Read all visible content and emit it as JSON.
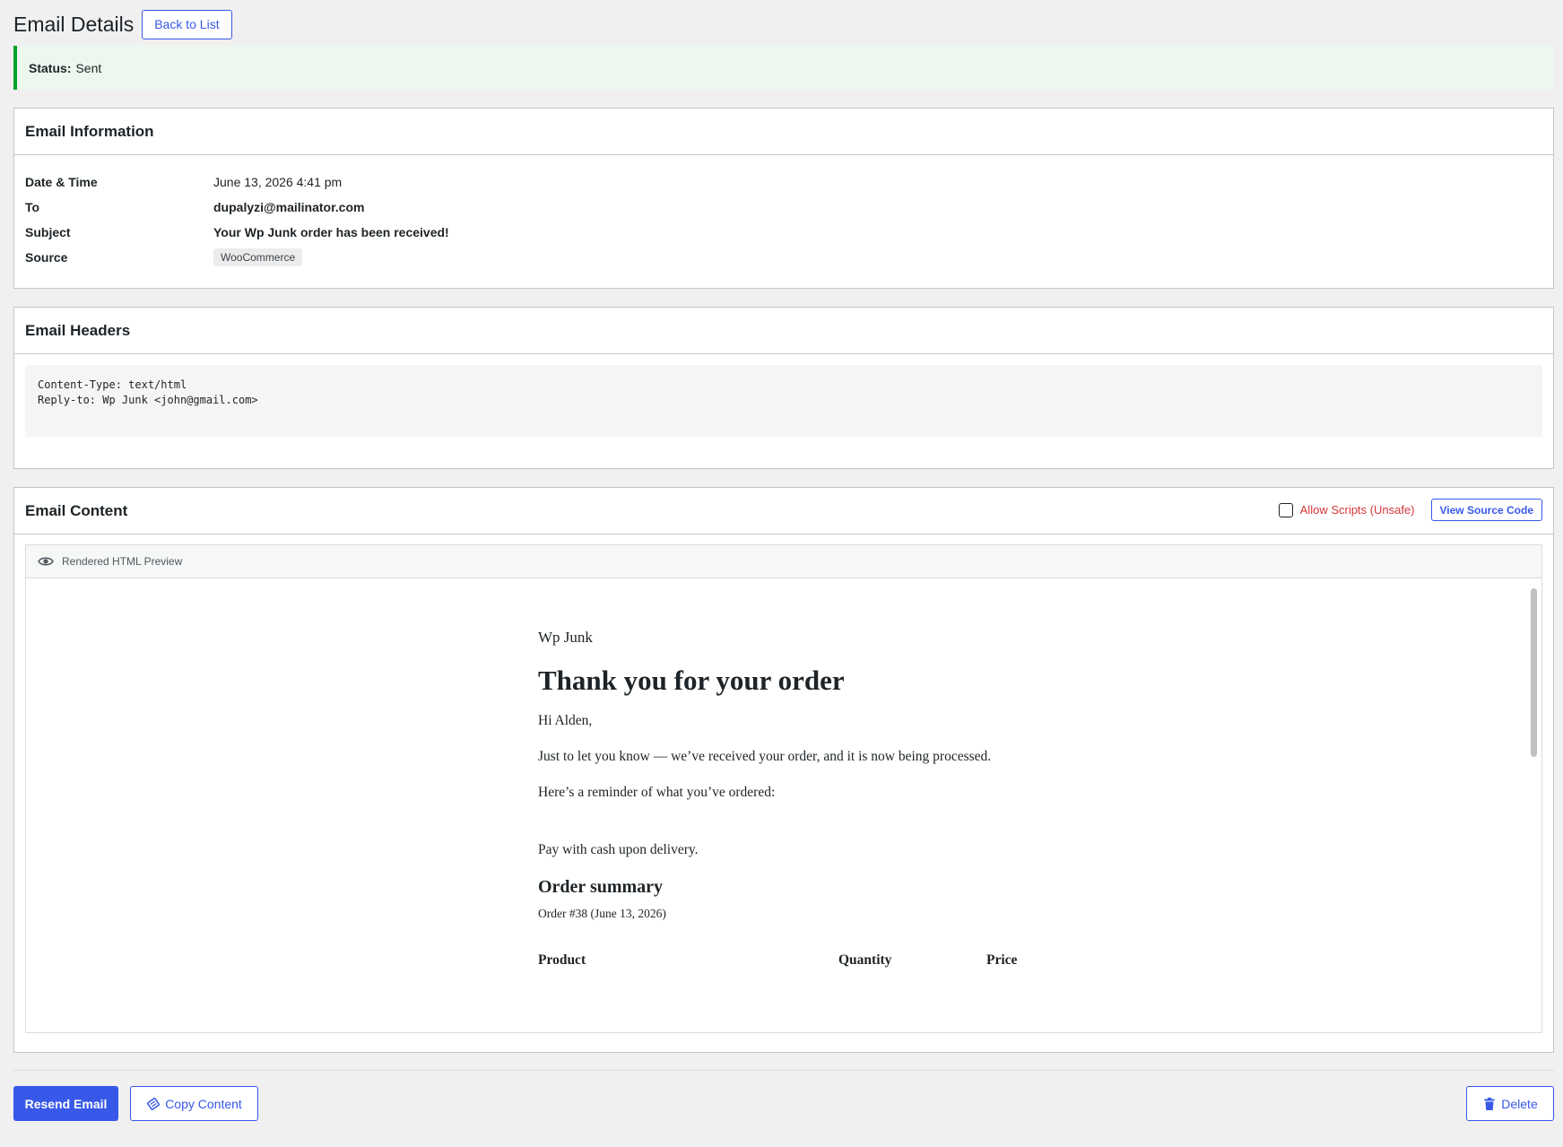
{
  "page": {
    "title": "Email Details",
    "back_label": "Back to List"
  },
  "status": {
    "label": "Status:",
    "value": "Sent"
  },
  "info": {
    "title": "Email Information",
    "rows": [
      {
        "label": "Date & Time",
        "value": "June 13, 2026 4:41 pm"
      },
      {
        "label": "To",
        "value": "dupalyzi@mailinator.com"
      },
      {
        "label": "Subject",
        "value": "Your Wp Junk order has been received!"
      },
      {
        "label": "Source",
        "value": "WooCommerce"
      }
    ]
  },
  "headers": {
    "title": "Email Headers",
    "lines": [
      "Content-Type: text/html",
      "Reply-to: Wp Junk <john@gmail.com>"
    ]
  },
  "content": {
    "title": "Email Content",
    "allow_scripts_label": "Allow Scripts (Unsafe)",
    "allow_scripts_checked": false,
    "view_source_label": "View Source Code",
    "preview_label": "Rendered HTML Preview",
    "icons": {
      "preview": "eye-icon"
    }
  },
  "email": {
    "brand": "Wp Junk",
    "heading": "Thank you for your order",
    "greeting": "Hi Alden,",
    "line1": "Just to let you know — we’ve received your order, and it is now being processed.",
    "line2": "Here’s a reminder of what you’ve ordered:",
    "payment": "Pay with cash upon delivery.",
    "summary_title": "Order summary",
    "order_line": "Order #38 (June 13, 2026)",
    "columns": [
      "Product",
      "Quantity",
      "Price"
    ]
  },
  "actions": {
    "resend_label": "Resend Email",
    "copy_label": "Copy Content",
    "delete_label": "Delete",
    "icons": {
      "copy": "copy-icon",
      "delete": "trash-icon"
    }
  },
  "colors": {
    "accent": "#3858e9",
    "success": "#00a32a",
    "danger": "#d63638"
  }
}
